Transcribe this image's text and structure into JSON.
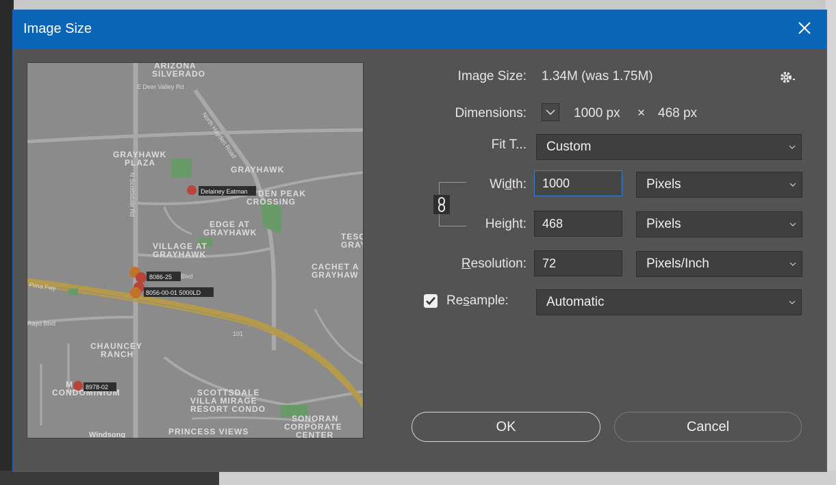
{
  "dialog": {
    "title": "Image Size",
    "close_icon": "close-icon"
  },
  "preview": {
    "labels": {
      "arizona": "ARIZONA",
      "silverado": "SILVERADO",
      "deer_valley": "E Deer Valley Rd",
      "hayden": "North Hayden Road",
      "grayhawk_plaza_1": "GRAYHAWK",
      "grayhawk_plaza_2": "PLAZA",
      "grayhawk": "GRAYHAWK",
      "scottsdale_rd": "N Scottsdale Rd",
      "den_peak": "DEN PEAK",
      "crossing": "CROSSING",
      "edge_at_1": "EDGE AT",
      "edge_at_2": "GRAYHAWK",
      "village_at_1": "VILLAGE AT",
      "village_at_2": "GRAYHAWK",
      "tesc": "TESC",
      "gray": "GRAY",
      "cachet_1": "CACHET A",
      "cachet_2": "GRAYHAW",
      "pima": "Pima Fwy",
      "blvd": "Blvd",
      "rayo": "Rayo Blvd",
      "hwy101": "101",
      "chauncey_1": "CHAUNCEY",
      "chauncey_2": "RANCH",
      "condo_1": "M",
      "condo_2": "CONDOMINIUM",
      "villa_1": "SCOTTSDALE",
      "villa_2": "VILLA MIRAGE",
      "villa_3": "RESORT CONDO",
      "sonoran_1": "SONORAN",
      "sonoran_2": "CORPORATE",
      "sonoran_3": "CENTER",
      "princess": "PRINCESS VIEWS",
      "windsong": "Windsong"
    },
    "pins": {
      "delainey": "Delainey Eatman",
      "p8086": "8086-25",
      "p8056": "8056-00-01 5000LD",
      "p8978": "8978-02"
    }
  },
  "form": {
    "image_size_label": "Image Size:",
    "image_size_value": "1.34M (was 1.75M)",
    "settings_icon": "gear-icon",
    "dimensions_label": "Dimensions:",
    "dimensions_width": "1000 px",
    "dimensions_times": "×",
    "dimensions_height": "468 px",
    "fit_label": "Fit T...",
    "fit_value": "Custom",
    "width_label_pre": "Wi",
    "width_label_u": "d",
    "width_label_post": "th:",
    "width_value": "1000",
    "width_unit": "Pixels",
    "height_label_pre": "Hei",
    "height_label_u": "g",
    "height_label_post": "ht:",
    "height_value": "468",
    "height_unit": "Pixels",
    "resolution_label_u": "R",
    "resolution_label_post": "esolution:",
    "resolution_value": "72",
    "resolution_unit": "Pixels/Inch",
    "resample_label_pre": "Re",
    "resample_label_u": "s",
    "resample_label_post": "ample:",
    "resample_checked": true,
    "resample_value": "Automatic"
  },
  "buttons": {
    "ok": "OK",
    "cancel": "Cancel"
  },
  "colors": {
    "titlebar": "#0a64b8",
    "dialog_bg": "#535353",
    "field_bg": "#3f3f3f",
    "focus": "#3a7fcf"
  }
}
